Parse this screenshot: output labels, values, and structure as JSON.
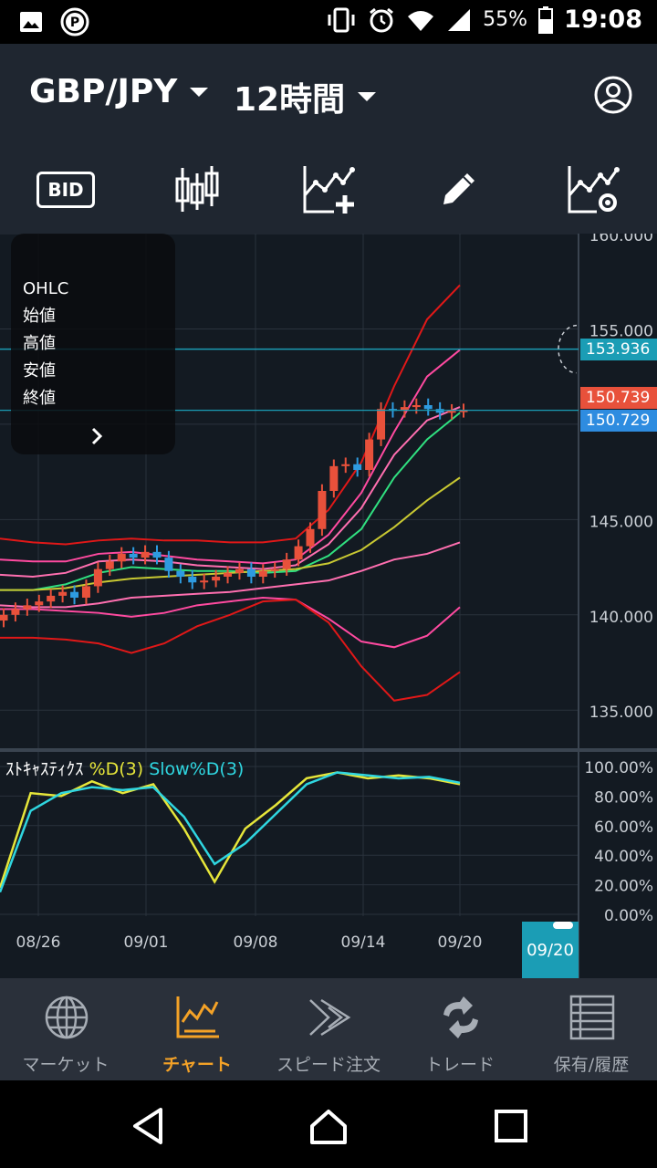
{
  "status_bar": {
    "battery": "55%",
    "time": "19:08",
    "icons": [
      "image-icon",
      "p-circle-icon",
      "vibrate-icon",
      "alarm-icon",
      "wifi-icon",
      "signal-icon",
      "battery-icon"
    ]
  },
  "header": {
    "pair": "GBP/JPY",
    "period": "12時間",
    "account_icon": "user-circle-icon"
  },
  "toolbar": {
    "bid_label": "BID",
    "tools": [
      "candlestick-icon",
      "add-indicator-icon",
      "pencil-icon",
      "indicator-settings-icon"
    ]
  },
  "ohlc_panel": {
    "title": "OHLC",
    "rows": [
      "始値",
      "高値",
      "安値",
      "終値"
    ],
    "toggle": "›"
  },
  "price_tags": {
    "level_line": "153.936",
    "ask": "150.739",
    "bid": "150.729"
  },
  "stochastic_label": {
    "name": "ｽﾄｷｬｽﾃｨｸｽ",
    "d": "%D(3)",
    "slow_d": "Slow%D(3)"
  },
  "selected_date": "09/20",
  "colors": {
    "background": "#131a22",
    "header": "#1f2630",
    "nav": "#2a303a",
    "bull_candle": "#e8513b",
    "bear_candle": "#2e9be0",
    "accent_cyan": "#1b9db5",
    "active_nav": "#f4a227",
    "stoch_d": "#e6e63a",
    "stoch_slow": "#2fd6e0"
  },
  "chart_data": [
    {
      "type": "line",
      "title": "",
      "x": [
        "08/26",
        "09/01",
        "09/08",
        "09/14",
        "09/20"
      ],
      "ylim": [
        133,
        160
      ],
      "y_ticks": [
        "160.000",
        "155.000",
        "145.000",
        "140.000",
        "135.000"
      ],
      "candles_close": [
        140.0,
        140.3,
        140.5,
        140.7,
        141.0,
        141.2,
        140.9,
        141.5,
        142.4,
        142.8,
        143.2,
        143.0,
        143.3,
        143.0,
        142.3,
        142.0,
        141.7,
        141.8,
        142.0,
        142.2,
        142.4,
        142.0,
        142.3,
        142.4,
        142.9,
        143.6,
        144.5,
        146.5,
        147.8,
        147.9,
        147.6,
        149.2,
        150.8,
        150.7,
        150.9,
        151.0,
        150.8,
        150.6,
        150.7,
        150.73
      ],
      "series": [
        {
          "name": "",
          "color": "#e01818",
          "values": [
            144.0,
            143.8,
            143.7,
            143.9,
            144.0,
            143.9,
            143.9,
            143.8,
            143.8,
            144.0,
            145.5,
            148.0,
            152.0,
            155.5,
            157.3
          ]
        },
        {
          "name": "",
          "color": "#ff4aa0",
          "values": [
            142.9,
            142.8,
            142.8,
            143.2,
            143.3,
            143.1,
            142.9,
            142.8,
            142.7,
            142.9,
            144.2,
            146.4,
            149.6,
            152.5,
            153.9
          ]
        },
        {
          "name": "",
          "color": "#ff6fb0",
          "values": [
            142.1,
            142.0,
            142.2,
            142.8,
            142.9,
            142.8,
            142.6,
            142.5,
            142.4,
            142.6,
            143.7,
            145.6,
            148.4,
            150.2,
            150.9
          ]
        },
        {
          "name": "",
          "color": "#30e080",
          "values": [
            141.3,
            141.3,
            141.6,
            142.2,
            142.5,
            142.4,
            142.3,
            142.3,
            142.2,
            142.3,
            143.1,
            144.5,
            147.2,
            149.2,
            150.6
          ]
        },
        {
          "name": "",
          "color": "#c8c832",
          "values": [
            141.3,
            141.3,
            141.4,
            141.7,
            141.9,
            142.0,
            142.1,
            142.2,
            142.3,
            142.4,
            142.7,
            143.4,
            144.6,
            146.0,
            147.2
          ]
        },
        {
          "name": "",
          "color": "#ff6fb0",
          "values": [
            140.5,
            140.4,
            140.4,
            140.6,
            140.9,
            141.0,
            141.1,
            141.2,
            141.4,
            141.6,
            141.8,
            142.3,
            142.9,
            143.2,
            143.8
          ]
        },
        {
          "name": "",
          "color": "#ff4aa0",
          "values": [
            140.3,
            140.3,
            140.2,
            140.1,
            139.9,
            140.1,
            140.5,
            140.7,
            140.9,
            140.8,
            139.8,
            138.6,
            138.3,
            138.9,
            140.4
          ]
        },
        {
          "name": "",
          "color": "#e01818",
          "values": [
            138.8,
            138.8,
            138.7,
            138.5,
            138.0,
            138.5,
            139.4,
            140.0,
            140.7,
            140.8,
            139.6,
            137.3,
            135.5,
            135.8,
            137.0
          ]
        }
      ]
    },
    {
      "type": "line",
      "title": "",
      "x": [
        "08/26",
        "09/01",
        "09/08",
        "09/14",
        "09/20"
      ],
      "ylim": [
        0,
        100
      ],
      "y_ticks": [
        "100.00%",
        "80.00%",
        "60.00%",
        "40.00%",
        "20.00%",
        "0.00%"
      ],
      "series": [
        {
          "name": "%D(3)",
          "color": "#e6e63a",
          "values": [
            18,
            82,
            80,
            90,
            82,
            88,
            58,
            22,
            58,
            74,
            92,
            96,
            92,
            94,
            92,
            88
          ]
        },
        {
          "name": "Slow%D(3)",
          "color": "#2fd6e0",
          "values": [
            15,
            70,
            82,
            86,
            84,
            86,
            66,
            34,
            48,
            68,
            88,
            96,
            94,
            92,
            93,
            89
          ]
        }
      ]
    }
  ],
  "date_axis": [
    "08/26",
    "09/01",
    "09/08",
    "09/14",
    "09/20"
  ],
  "bottom_nav": [
    {
      "label": "マーケット",
      "icon": "globe-icon",
      "active": false
    },
    {
      "label": "チャート",
      "icon": "chart-icon",
      "active": true
    },
    {
      "label": "スピード注文",
      "icon": "speed-order-icon",
      "active": false
    },
    {
      "label": "トレード",
      "icon": "trade-icon",
      "active": false
    },
    {
      "label": "保有/履歴",
      "icon": "list-icon",
      "active": false
    }
  ]
}
